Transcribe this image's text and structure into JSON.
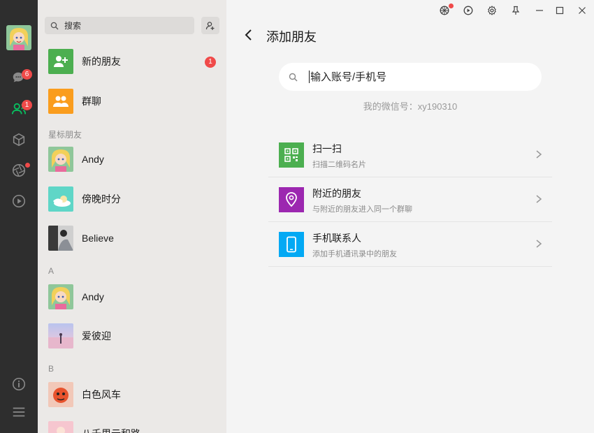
{
  "nav": {
    "chats_badge": "6",
    "contacts_badge": "1"
  },
  "list": {
    "search_placeholder": "搜索",
    "new_friends": {
      "label": "新的朋友",
      "badge": "1"
    },
    "group_chat": {
      "label": "群聊"
    },
    "sections": {
      "starred": "星标朋友",
      "a": "A",
      "b": "B"
    },
    "starred": [
      {
        "name": "Andy"
      },
      {
        "name": "傍晚时分"
      },
      {
        "name": "Believe"
      }
    ],
    "group_a": [
      {
        "name": "Andy"
      },
      {
        "name": "爱彼迎"
      }
    ],
    "group_b": [
      {
        "name": "白色风车"
      },
      {
        "name": "八千里云和路"
      }
    ]
  },
  "main": {
    "title": "添加朋友",
    "search_placeholder": "输入账号/手机号",
    "wechat_id": "我的微信号：xy190310",
    "options": [
      {
        "title": "扫一扫",
        "subtitle": "扫描二维码名片",
        "color": "#4caf50",
        "icon": "qr-scan-icon"
      },
      {
        "title": "附近的朋友",
        "subtitle": "与附近的朋友进入同一个群聊",
        "color": "#9c27b0",
        "icon": "location-pin-icon"
      },
      {
        "title": "手机联系人",
        "subtitle": "添加手机通讯录中的朋友",
        "color": "#03a9f4",
        "icon": "phone-icon"
      }
    ]
  },
  "colors": {
    "accent_green": "#07c160",
    "badge_red": "#f04a49"
  }
}
